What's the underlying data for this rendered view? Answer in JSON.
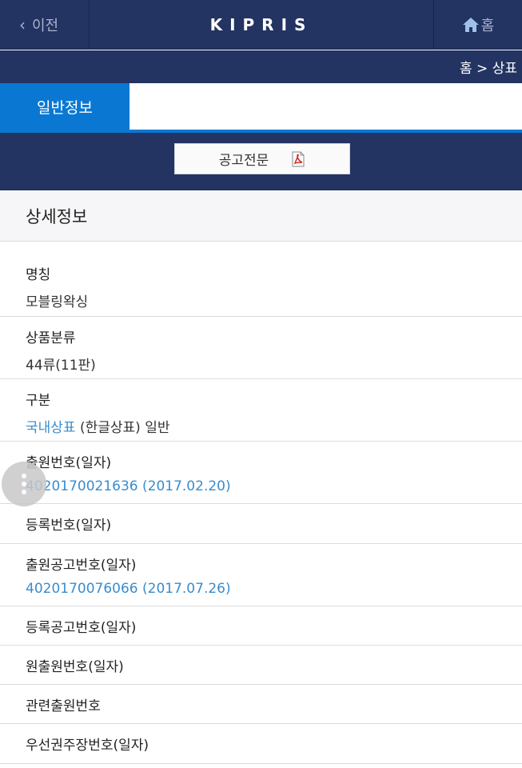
{
  "header": {
    "back_label": "이전",
    "logo_text": "KIPRIS",
    "home_label": "홈"
  },
  "breadcrumb": "홈 > 상표",
  "tabs": {
    "active_label": "일반정보"
  },
  "notice_button": {
    "label": "공고전문",
    "icon": "pdf-icon"
  },
  "section_title": "상세정보",
  "fields": {
    "name": {
      "label": "명칭",
      "value": "모블링왁싱"
    },
    "class": {
      "label": "상품분류",
      "value": "44류(11판)"
    },
    "type": {
      "label": "구분",
      "link": "국내상표",
      "rest": "(한글상표) 일반"
    },
    "app_no": {
      "label": "출원번호(일자)",
      "value": "4020170021636 (2017.02.20)"
    },
    "reg_no": {
      "label": "등록번호(일자)"
    },
    "pub_no": {
      "label": "출원공고번호(일자)",
      "value": "4020170076066 (2017.07.26)"
    },
    "reg_pub_no": {
      "label": "등록공고번호(일자)"
    },
    "orig_app_no": {
      "label": "원출원번호(일자)"
    },
    "related_app_no": {
      "label": "관련출원번호"
    },
    "priority_no": {
      "label": "우선권주장번호(일자)"
    }
  },
  "colors": {
    "header_bg": "#233362",
    "tab_active": "#0a78d3",
    "link": "#3a8ccc"
  }
}
